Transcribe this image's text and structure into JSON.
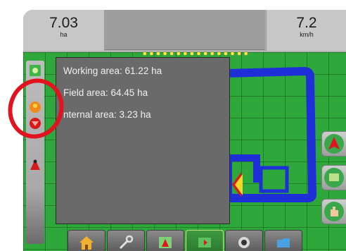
{
  "status": {
    "left_gauge": {
      "value": "7.03",
      "unit": "ha"
    },
    "right_gauge": {
      "value": "7.2",
      "unit": "km/h"
    }
  },
  "info_panel": {
    "rows": [
      {
        "label": "Working area",
        "value": "61.22 ha",
        "text": "Working area: 61.22 ha"
      },
      {
        "label": "Field area",
        "value": "64.45 ha",
        "text": "Field area: 64.45 ha"
      },
      {
        "label": "Internal area",
        "value": "3.23 ha",
        "text": "nternal area: 3.23 ha"
      }
    ]
  },
  "colors": {
    "field": "#2fa83b",
    "coverage": "#1f2fd8",
    "boom_sections": "#f3ea4d",
    "highlight_ring": "#e0131e"
  },
  "icons": {
    "sidebar": [
      "zoom-extents-icon",
      "marker-icon",
      "boundary-icon",
      "vehicle-icon"
    ],
    "right": [
      "vehicle-view-icon",
      "map-view-icon",
      "hand-pan-icon"
    ],
    "bottom_tabs": [
      "home-icon",
      "tools-icon",
      "guidance-icon",
      "map-icon",
      "camera-icon",
      "data-icon"
    ]
  }
}
